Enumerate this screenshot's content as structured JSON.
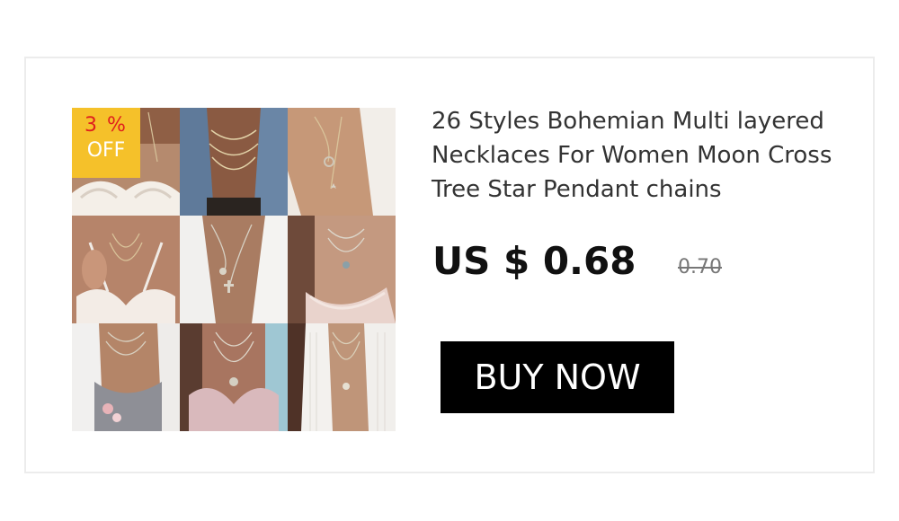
{
  "product": {
    "title": "26 Styles Bohemian Multi layered Necklaces For Women Moon Cross Tree Star Pendant chains",
    "price": "US $ 0.68",
    "original_price": "0.70"
  },
  "badge": {
    "percent": "3 %",
    "label": "OFF"
  },
  "cta": {
    "label": "BUY NOW"
  },
  "colors": {
    "badge_bg": "#f5c12a",
    "badge_percent": "#e0201d",
    "button_bg": "#000000",
    "button_text": "#ffffff"
  }
}
